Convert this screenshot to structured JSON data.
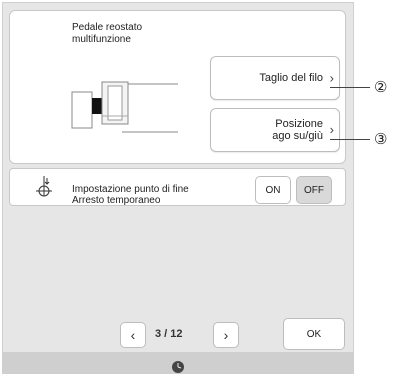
{
  "pedal_panel": {
    "title": "Pedale reostato multifunzione",
    "btn_thread_cut": "Taglio del filo",
    "btn_needle_pos": "Posizione ago su/giù"
  },
  "end_point": {
    "label": "Impostazione punto di fine Arresto temporaneo",
    "on_label": "ON",
    "off_label": "OFF",
    "selected": "OFF"
  },
  "pager": {
    "text": "3 / 12",
    "prev_icon": "chevron-left-icon",
    "next_icon": "chevron-right-icon"
  },
  "ok_label": "OK",
  "callouts": [
    "②",
    "③"
  ],
  "colors": {
    "selected_toggle": "#d9d9d9",
    "panel": "#ffffff",
    "background": "#e6e6e6"
  }
}
